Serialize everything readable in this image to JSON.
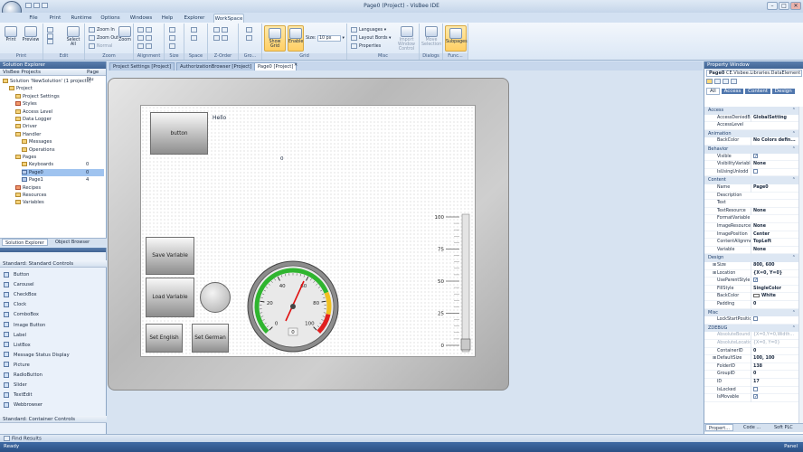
{
  "window": {
    "title": "Page0 (Project) - VisBee IDE",
    "min": "–",
    "max": "□",
    "close": "✕"
  },
  "ribbon_tabs": [
    "File",
    "Print",
    "Runtime",
    "Options",
    "Windows",
    "Help",
    "Explorer",
    "WorkSpace"
  ],
  "ribbon": {
    "print": {
      "print": "Print",
      "preview": "Preview",
      "label": "Print"
    },
    "edit": {
      "select_all": "Select All",
      "label": "Edit"
    },
    "zoom": {
      "zoom_in": "Zoom In",
      "zoom_out": "Zoom Out",
      "normal": "Normal",
      "zoom": "Zoom",
      "label": "Zoom"
    },
    "alignment": {
      "label": "Alignment"
    },
    "size": {
      "label": "Size"
    },
    "space": {
      "label": "Space"
    },
    "zorder": {
      "label": "Z-Order"
    },
    "group": {
      "label": "Gro..."
    },
    "grid": {
      "show_grid": "Show Grid",
      "enable": "Enable",
      "size_label": "Size:",
      "size_value": "10 px",
      "label": "Grid"
    },
    "misc": {
      "languages": "Languages",
      "layout_bords": "Layout Bords",
      "properties": "Properties",
      "import_window_control": "Import Window Control",
      "label": "Misc"
    },
    "dialogs": {
      "move_selection": "Move Selection",
      "label": "Dialogs"
    },
    "functions": {
      "subpages": "Subpages",
      "label": "Func..."
    }
  },
  "solution_explorer": {
    "header": "Solution Explorer",
    "tabs": [
      "VisBee Projects",
      "Page Nu"
    ],
    "tree": [
      {
        "label": "Solution 'NewSolution' (1 projects)",
        "indent": 0,
        "icon": "solution-icon"
      },
      {
        "label": "Project",
        "indent": 1,
        "icon": "project-icon"
      },
      {
        "label": "Project Settings",
        "indent": 2,
        "icon": "settings-icon"
      },
      {
        "label": "Styles",
        "indent": 2,
        "icon": "styles-icon"
      },
      {
        "label": "Access Level",
        "indent": 2,
        "icon": "access-icon"
      },
      {
        "label": "Data Logger",
        "indent": 2,
        "icon": "logger-icon"
      },
      {
        "label": "Driver",
        "indent": 2,
        "icon": "driver-icon"
      },
      {
        "label": "Handler",
        "indent": 2,
        "icon": "handler-icon"
      },
      {
        "label": "Messages",
        "indent": 3,
        "icon": "messages-icon"
      },
      {
        "label": "Operations",
        "indent": 3,
        "icon": "operations-icon"
      },
      {
        "label": "Pages",
        "indent": 2,
        "icon": "folder-icon"
      },
      {
        "label": "Keyboards",
        "indent": 3,
        "icon": "folder-icon",
        "num": "0"
      },
      {
        "label": "Page0",
        "indent": 3,
        "icon": "page-icon",
        "num": "0",
        "selected": true
      },
      {
        "label": "Page1",
        "indent": 3,
        "icon": "page-icon",
        "num": "4"
      },
      {
        "label": "Recipes",
        "indent": 2,
        "icon": "recipes-icon"
      },
      {
        "label": "Resources",
        "indent": 2,
        "icon": "resources-icon"
      },
      {
        "label": "Variables",
        "indent": 2,
        "icon": "variables-icon"
      }
    ],
    "bottom_tabs": [
      "Solution Explorer",
      "Object Browser"
    ]
  },
  "toolbox": {
    "section1": "Standard: Standard Controls",
    "items": [
      "Button",
      "Carousel",
      "CheckBox",
      "Clock",
      "ComboBox",
      "Image Button",
      "Label",
      "ListBox",
      "Message Status Display",
      "Picture",
      "RadioButton",
      "Slider",
      "TextEdit",
      "Webbrowser"
    ],
    "section2": "Standard: Container Controls"
  },
  "doc_tabs": [
    "Project Settings [Project]",
    "AuthorizationBrowser [Project]",
    "Page0 [Project]"
  ],
  "canvas": {
    "button": "button",
    "hello": "Hello",
    "zero": "0",
    "save_variable": "Save Variable",
    "load_variable": "Load Variable",
    "set_english": "Set English",
    "set_german": "Set German",
    "gauge_ticks": [
      "0",
      "20",
      "40",
      "60",
      "80",
      "100"
    ],
    "gauge_value": "0",
    "slider_ticks": [
      "100",
      "75",
      "50",
      "25",
      "0"
    ]
  },
  "properties": {
    "header": "Property Window",
    "object_name": "Page0",
    "object_type": "CE.Visbee.Libraries.DataElement",
    "tabs": [
      "All",
      "Access",
      "Content",
      "Design"
    ],
    "rows": [
      {
        "cat": "Access"
      },
      {
        "name": "AccessDeniedB",
        "value": "GlobalSetting"
      },
      {
        "name": "AccessLevel",
        "value": ""
      },
      {
        "cat": "Animation"
      },
      {
        "name": "BackColor",
        "value": "No Colors defin..."
      },
      {
        "cat": "Behavior"
      },
      {
        "name": "Visible",
        "check": true
      },
      {
        "name": "VisibilityVariable",
        "value": "None"
      },
      {
        "name": "IsUsingUnlodd",
        "check": false
      },
      {
        "cat": "Content"
      },
      {
        "name": "Name",
        "value": "Page0"
      },
      {
        "name": "Description",
        "value": ""
      },
      {
        "name": "Text",
        "value": ""
      },
      {
        "name": "TextResource",
        "value": "None"
      },
      {
        "name": "FormatVariable",
        "value": ""
      },
      {
        "name": "ImageResource",
        "value": "None"
      },
      {
        "name": "ImagePosition",
        "value": "Center"
      },
      {
        "name": "ContentAlignme",
        "value": "TopLeft"
      },
      {
        "name": "Variable",
        "value": "None"
      },
      {
        "cat": "Design"
      },
      {
        "name": "Size",
        "value": "800, 600",
        "expand": true
      },
      {
        "name": "Location",
        "value": "{X=0, Y=0}",
        "expand": true
      },
      {
        "name": "UseParentStyle",
        "check": true
      },
      {
        "name": "FillStyle",
        "value": "SingleColor"
      },
      {
        "name": "BackColor",
        "value": "White",
        "swatch": true
      },
      {
        "name": "Padding",
        "value": "0"
      },
      {
        "cat": "Misc"
      },
      {
        "name": "LockStartPositio",
        "check": false
      },
      {
        "cat": "ZDEBUG"
      },
      {
        "name": "AbsoluteBound",
        "value": "{X=0,Y=0,Width...",
        "grey": true
      },
      {
        "name": "AbsoluteLocatio",
        "value": "{X=0, Y=0}",
        "grey": true
      },
      {
        "name": "ContainerID",
        "value": "0"
      },
      {
        "name": "DefaultSize",
        "value": "100, 100",
        "expand": true
      },
      {
        "name": "FolderID",
        "value": "138"
      },
      {
        "name": "GroupID",
        "value": "0"
      },
      {
        "name": "ID",
        "value": "17"
      },
      {
        "name": "IsLocked",
        "check": false
      },
      {
        "name": "IsMovable",
        "check": true
      }
    ],
    "bottom_tabs": [
      "Propert...",
      "Code ...",
      "Soft PLC"
    ]
  },
  "find_results": "Find Results",
  "status": {
    "left": "Ready",
    "right": "Panel"
  },
  "colors": {
    "accent": "#2a4f84",
    "selection": "#9fc3ef",
    "highlight": "#ffcf64",
    "needle": "#e01010",
    "gauge_green": "#2fb52f",
    "gauge_red": "#e02020"
  }
}
